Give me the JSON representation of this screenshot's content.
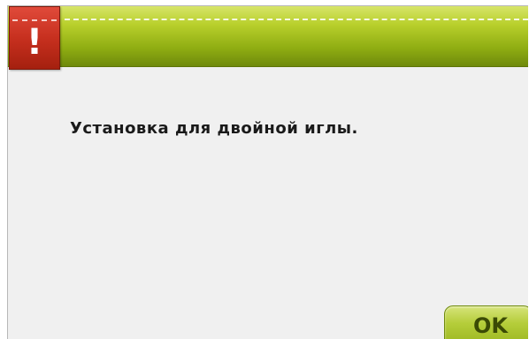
{
  "dialog": {
    "icon": "exclamation-icon",
    "warning_symbol": "!",
    "message": "Установка для двойной иглы.",
    "ok_label": "OK"
  },
  "colors": {
    "header_green": "#a8c222",
    "warning_red": "#c7301f",
    "background": "#f0f0f0",
    "button_green": "#b5cd3a"
  }
}
